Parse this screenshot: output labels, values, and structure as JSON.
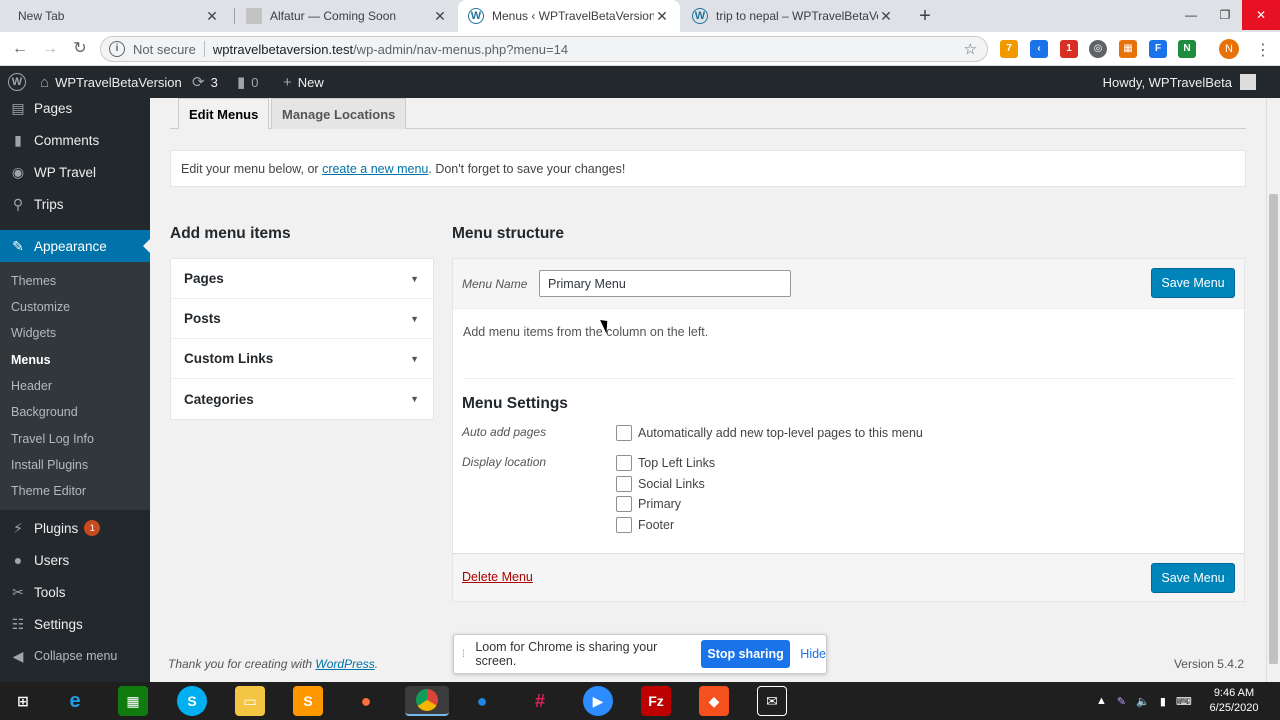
{
  "browser": {
    "tabs": [
      {
        "title": "New Tab",
        "favicon": "",
        "active": false
      },
      {
        "title": "Alfatur — Coming Soon",
        "favicon": "page-icon",
        "active": false
      },
      {
        "title": "Menus ‹ WPTravelBetaVersion —",
        "favicon": "wordpress-icon",
        "active": true
      },
      {
        "title": "trip to nepal – WPTravelBetaVersi",
        "favicon": "wordpress-icon",
        "active": false
      }
    ],
    "not_secure": "Not secure",
    "url_host": "wptravelbetaversion.test",
    "url_path": "/wp-admin/nav-menus.php?menu=14",
    "profile_initial": "N",
    "ext_badges": {
      "rss": "7",
      "red": "1"
    }
  },
  "adminbar": {
    "site_name": "WPTravelBetaVersion",
    "updates_count": "3",
    "comments_count": "0",
    "new_label": "New",
    "howdy": "Howdy, WPTravelBeta"
  },
  "sidebar": {
    "items": [
      {
        "label": "Pages",
        "icon": "pages-icon"
      },
      {
        "label": "Comments",
        "icon": "comments-icon"
      },
      {
        "label": "WP Travel",
        "icon": "wptravel-icon"
      },
      {
        "label": "Trips",
        "icon": "pin-icon"
      },
      {
        "label": "Appearance",
        "icon": "brush-icon"
      }
    ],
    "submenu": [
      "Themes",
      "Customize",
      "Widgets",
      "Menus",
      "Header",
      "Background",
      "Travel Log Info",
      "Install Plugins",
      "Theme Editor"
    ],
    "lower_items": [
      {
        "label": "Plugins",
        "icon": "plug-icon",
        "badge": "1"
      },
      {
        "label": "Users",
        "icon": "users-icon"
      },
      {
        "label": "Tools",
        "icon": "wrench-icon"
      },
      {
        "label": "Settings",
        "icon": "settings-icon"
      },
      {
        "label": "Collapse menu",
        "icon": "collapse-icon"
      }
    ]
  },
  "main": {
    "tabs": [
      "Edit Menus",
      "Manage Locations"
    ],
    "notice_prefix": "Edit your menu below, or ",
    "notice_link": "create a new menu",
    "notice_suffix": ". Don't forget to save your changes!",
    "add_items_title": "Add menu items",
    "accordion": [
      "Pages",
      "Posts",
      "Custom Links",
      "Categories"
    ],
    "structure_title": "Menu structure",
    "menu_name_label": "Menu Name",
    "menu_name_value": "Primary Menu",
    "save_label": "Save Menu",
    "empty_text": "Add menu items from the column on the left.",
    "settings_title": "Menu Settings",
    "auto_add_label": "Auto add pages",
    "auto_add_option": "Automatically add new top-level pages to this menu",
    "display_location_label": "Display location",
    "locations": [
      "Top Left Links",
      "Social Links",
      "Primary",
      "Footer"
    ],
    "delete_label": "Delete Menu",
    "footer_thanks": "Thank you for creating with ",
    "footer_link": "WordPress",
    "footer_dot": ".",
    "version": "Version 5.4.2"
  },
  "loom": {
    "message": "Loom for Chrome is sharing your screen.",
    "stop_label": "Stop sharing",
    "hide_label": "Hide"
  },
  "taskbar": {
    "time": "9:46 AM",
    "date": "6/25/2020"
  }
}
